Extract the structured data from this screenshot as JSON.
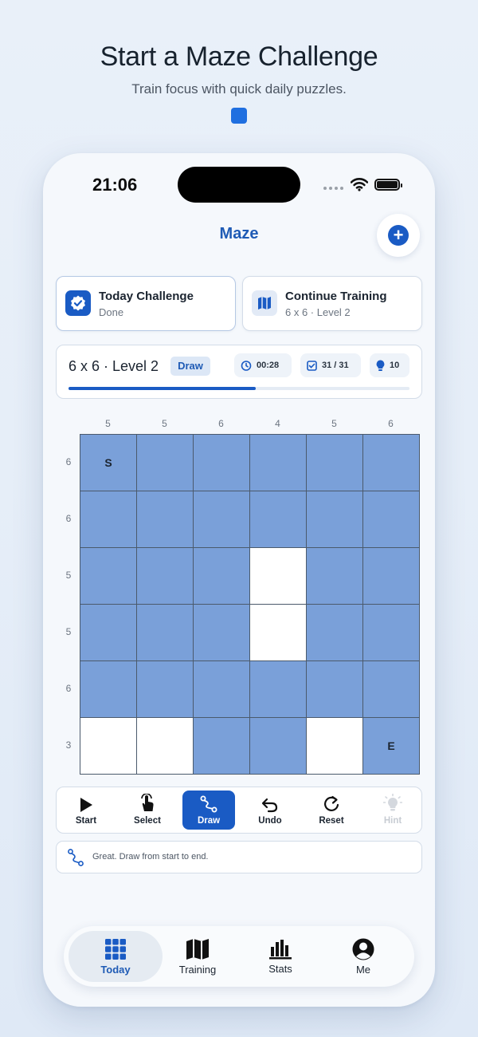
{
  "hero": {
    "title": "Start a Maze Challenge",
    "subtitle": "Train focus with quick daily puzzles."
  },
  "status_bar": {
    "time": "21:06"
  },
  "header": {
    "title": "Maze",
    "add_icon": "plus-circle-icon"
  },
  "cards": {
    "today": {
      "title": "Today Challenge",
      "subtitle": "Done",
      "icon": "verified-badge-icon"
    },
    "training": {
      "title": "Continue Training",
      "subtitle": "6 x 6 · Level 2",
      "icon": "map-icon"
    }
  },
  "level": {
    "name": "6 x 6 · Level 2",
    "mode": "Draw",
    "timer": "00:28",
    "moves": "31 / 31",
    "hints": "10",
    "progress": 0.55
  },
  "puzzle": {
    "col_clues": [
      "5",
      "5",
      "6",
      "4",
      "5",
      "6"
    ],
    "row_clues": [
      "6",
      "6",
      "5",
      "5",
      "6",
      "3"
    ],
    "cells": [
      [
        1,
        1,
        1,
        1,
        1,
        1
      ],
      [
        1,
        1,
        1,
        1,
        1,
        1
      ],
      [
        1,
        1,
        1,
        0,
        1,
        1
      ],
      [
        1,
        1,
        1,
        0,
        1,
        1
      ],
      [
        1,
        1,
        1,
        1,
        1,
        1
      ],
      [
        0,
        0,
        1,
        1,
        0,
        1
      ]
    ],
    "start_label": "S",
    "end_label": "E",
    "colors": {
      "filled": "#7aa0d9",
      "empty": "#ffffff",
      "accent": "#1a5bc4"
    }
  },
  "toolbar": {
    "start": "Start",
    "select": "Select",
    "draw": "Draw",
    "undo": "Undo",
    "reset": "Reset",
    "hint": "Hint"
  },
  "hint_message": "Great. Draw from start to end.",
  "tabs": {
    "today": "Today",
    "training": "Training",
    "stats": "Stats",
    "me": "Me"
  }
}
